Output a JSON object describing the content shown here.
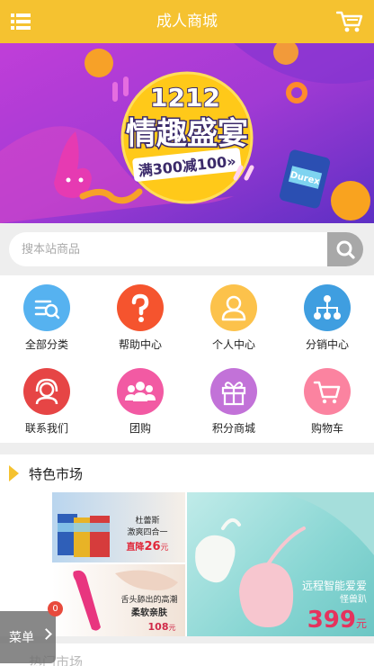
{
  "header": {
    "title": "成人商城",
    "menu_icon": "list-menu-icon",
    "cart_icon": "shopping-cart-icon",
    "background": "#f5c230"
  },
  "banner": {
    "number": "1212",
    "headline": "情趣盛宴",
    "promo": "满300减100»",
    "box_label": "Durex"
  },
  "search": {
    "placeholder": "搜本站商品",
    "icon": "search-icon"
  },
  "nav": [
    {
      "label": "全部分类",
      "icon": "category-list-icon",
      "color": "#56b2f0"
    },
    {
      "label": "帮助中心",
      "icon": "question-icon",
      "color": "#f5542e"
    },
    {
      "label": "个人中心",
      "icon": "user-icon",
      "color": "#fcc24b"
    },
    {
      "label": "分销中心",
      "icon": "network-icon",
      "color": "#3f9ee0"
    },
    {
      "label": "联系我们",
      "icon": "customer-service-icon",
      "color": "#e64545"
    },
    {
      "label": "团购",
      "icon": "group-icon",
      "color": "#f25aa3"
    },
    {
      "label": "积分商城",
      "icon": "gift-icon",
      "color": "#c272d8"
    },
    {
      "label": "购物车",
      "icon": "cart-icon",
      "color": "#fb83a0"
    }
  ],
  "featured": {
    "title": "特色市场",
    "products": [
      {
        "line1": "杜蕾斯",
        "line2": "激爽四合一",
        "price_label": "直降",
        "price": "26",
        "unit": "元"
      },
      {
        "line1": "舌头舔出的高潮",
        "line2": "柔软亲肤",
        "price": "108",
        "unit": "元"
      },
      {
        "line1": "远程智能爱爱",
        "line2": "怪兽趴",
        "price": "399",
        "unit": "元"
      }
    ]
  },
  "next_section": {
    "title": "热门市场"
  },
  "float_menu": {
    "label": "菜单",
    "badge": "0"
  }
}
